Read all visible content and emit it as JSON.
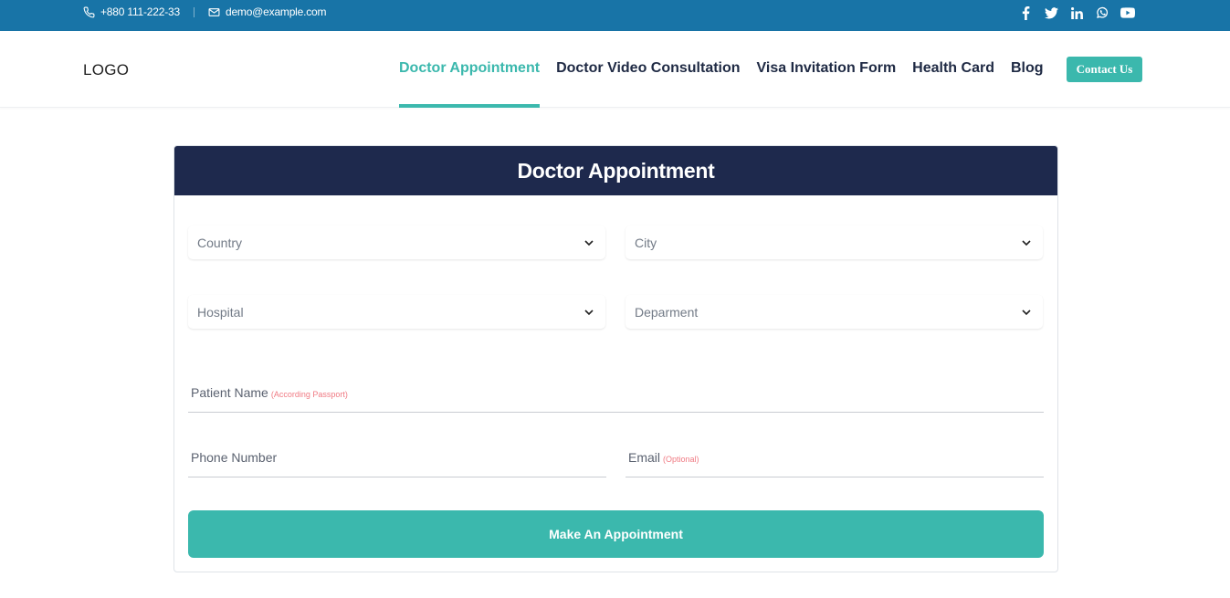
{
  "topbar": {
    "phone": "+880 111-222-33",
    "email": "demo@example.com",
    "social_icons": [
      "facebook-icon",
      "twitter-icon",
      "linkedin-icon",
      "whatsapp-icon",
      "youtube-icon"
    ]
  },
  "header": {
    "logo": "LOGO",
    "nav": [
      {
        "label": "Doctor Appointment",
        "active": true
      },
      {
        "label": "Doctor Video Consultation",
        "active": false
      },
      {
        "label": "Visa Invitation Form",
        "active": false
      },
      {
        "label": "Health Card",
        "active": false
      },
      {
        "label": "Blog",
        "active": false
      }
    ],
    "contact_button": "Contact Us"
  },
  "form": {
    "title": "Doctor Appointment",
    "selects": {
      "country": "Country",
      "city": "City",
      "hospital": "Hospital",
      "department": "Deparment"
    },
    "fields": {
      "patient_name": {
        "label": "Patient Name",
        "hint": "(According Passport)"
      },
      "phone": {
        "label": "Phone Number"
      },
      "email": {
        "label": "Email",
        "hint": "(Optional)"
      }
    },
    "submit": "Make An Appointment"
  },
  "colors": {
    "topbar": "#1874a7",
    "accent": "#3bb8ad",
    "card_header": "#1e294d",
    "hint": "#f07a83"
  }
}
